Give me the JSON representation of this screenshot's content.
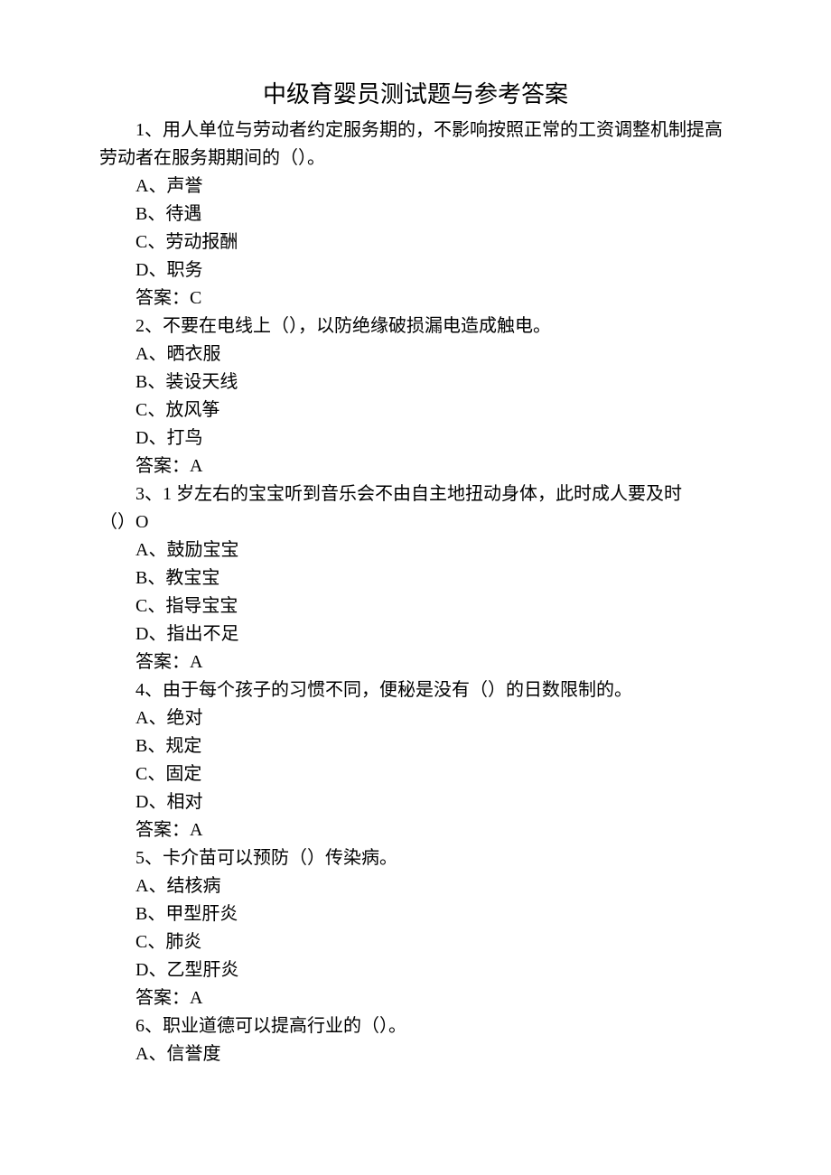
{
  "title": "中级育婴员测试题与参考答案",
  "q1": {
    "stem": "1、用人单位与劳动者约定服务期的，不影响按照正常的工资调整机制提高劳动者在服务期期间的（）。",
    "A": "A、声誉",
    "B": "B、待遇",
    "C": "C、劳动报酬",
    "D": "D、职务",
    "answer": "答案：C"
  },
  "q2": {
    "stem": "2、不要在电线上（），以防绝缘破损漏电造成触电。",
    "A": "A、晒衣服",
    "B": "B、装设天线",
    "C": "C、放风筝",
    "D": "D、打鸟",
    "answer": "答案：A"
  },
  "q3": {
    "stem_line1": "3、1 岁左右的宝宝听到音乐会不由自主地扭动身体，此时成人要及时",
    "stem_line2": "（）O",
    "A": "A、鼓励宝宝",
    "B": "B、教宝宝",
    "C": "C、指导宝宝",
    "D": "D、指出不足",
    "answer": "答案：A"
  },
  "q4": {
    "stem": "4、由于每个孩子的习惯不同，便秘是没有（）的日数限制的。",
    "A": "A、绝对",
    "B": "B、规定",
    "C": "C、固定",
    "D": "D、相对",
    "answer": "答案：A"
  },
  "q5": {
    "stem": "5、卡介苗可以预防（）传染病。",
    "A": "A、结核病",
    "B": "B、甲型肝炎",
    "C": "C、肺炎",
    "D": "D、乙型肝炎",
    "answer": "答案：A"
  },
  "q6": {
    "stem": "6、职业道德可以提高行业的（）。",
    "A": "A、信誉度"
  }
}
